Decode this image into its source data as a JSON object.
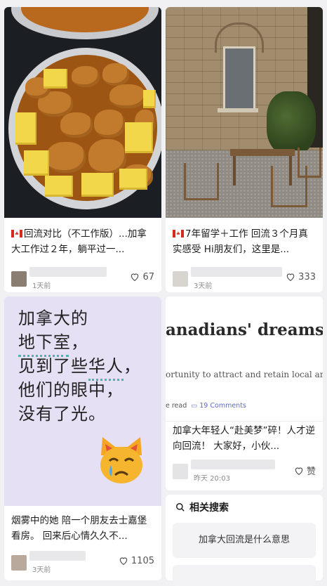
{
  "cards": [
    {
      "title": "回流对比（不工作版）...加拿大工作过２年，躺平过一...",
      "flag": "canada-flag-icon",
      "time": "1天前",
      "likes": "67"
    },
    {
      "title": "7年留学＋工作 回流３个月真实感受 Hi朋友们，这里是...",
      "flag": "canada-flag-icon",
      "time": "3天前",
      "likes": "333"
    },
    {
      "image_text": [
        "加拿大的",
        "地下室，",
        "见到了些华人，",
        "他们的眼中，",
        "没有了光。"
      ],
      "title": "烟雾中的她 陪一个朋友去士嘉堡看房。 回来后心情久久不...",
      "time": "3天前",
      "likes": "1105"
    },
    {
      "headline": "anadians' dreams o",
      "subline": "ortunity to attract and retain local ar",
      "read": "e read",
      "comments": "19 Comments",
      "title": "加拿大年轻人“赴美梦”碎！人才逆向回流！ 大家好，小伙...",
      "time": "昨天 20:03",
      "likes": "赞"
    }
  ],
  "related": {
    "title": "相关搜索",
    "items": [
      "加拿大回流是什么意思"
    ]
  },
  "colors": {
    "accent_underline": "#4db3b0",
    "text_card_bg": "#e6e0f5"
  }
}
